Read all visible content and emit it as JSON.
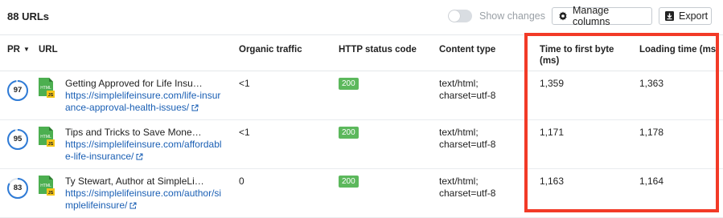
{
  "toolbar": {
    "urls_count": "88 URLs",
    "show_changes_label": "Show changes",
    "manage_columns_label": "Manage columns",
    "export_label": "Export"
  },
  "columns": {
    "pr": "PR",
    "url": "URL",
    "organic_traffic": "Organic traffic",
    "http_status": "HTTP status code",
    "content_type": "Content type",
    "ttfb_line1": "Time to first byte",
    "ttfb_line2": "(ms)",
    "loading_time": "Loading time (ms)"
  },
  "rows": [
    {
      "pr": "97",
      "pr_fill": 0.97,
      "title": "Getting Approved for Life Insu…",
      "url_line1": "https://simplelifeinsure.com/life-insu",
      "url_line2": "rance-approval-health-issues/",
      "traffic": "<1",
      "status": "200",
      "content_line1": "text/html;",
      "content_line2": "charset=utf-8",
      "ttfb": "1,359",
      "loading": "1,363"
    },
    {
      "pr": "95",
      "pr_fill": 0.95,
      "title": "Tips and Tricks to Save Mone…",
      "url_line1": "https://simplelifeinsure.com/afforda",
      "url_line2": "ble-life-insurance/",
      "traffic": "<1",
      "status": "200",
      "content_line1": "text/html;",
      "content_line2": "charset=utf-8",
      "ttfb": "1,171",
      "loading": "1,178"
    },
    {
      "pr": "83",
      "pr_fill": 0.83,
      "title": "Ty Stewart, Author at SimpleLi…",
      "url_line1": "https://simplelifeinsure.com/author/",
      "url_line2": "simplelifeinsure/",
      "traffic": "0",
      "status": "200",
      "content_line1": "text/html;",
      "content_line2": "charset=utf-8",
      "ttfb": "1,163",
      "loading": "1,164"
    }
  ],
  "file_icon_text": "HTML",
  "file_icon_badge": "JS",
  "colors": {
    "link": "#1a5fb4",
    "status_ok": "#5cb85c",
    "pr_ring": "#2f7bd6",
    "highlight": "#f23a27",
    "file_icon": "#4caf50",
    "js_badge": "#f5c518"
  }
}
